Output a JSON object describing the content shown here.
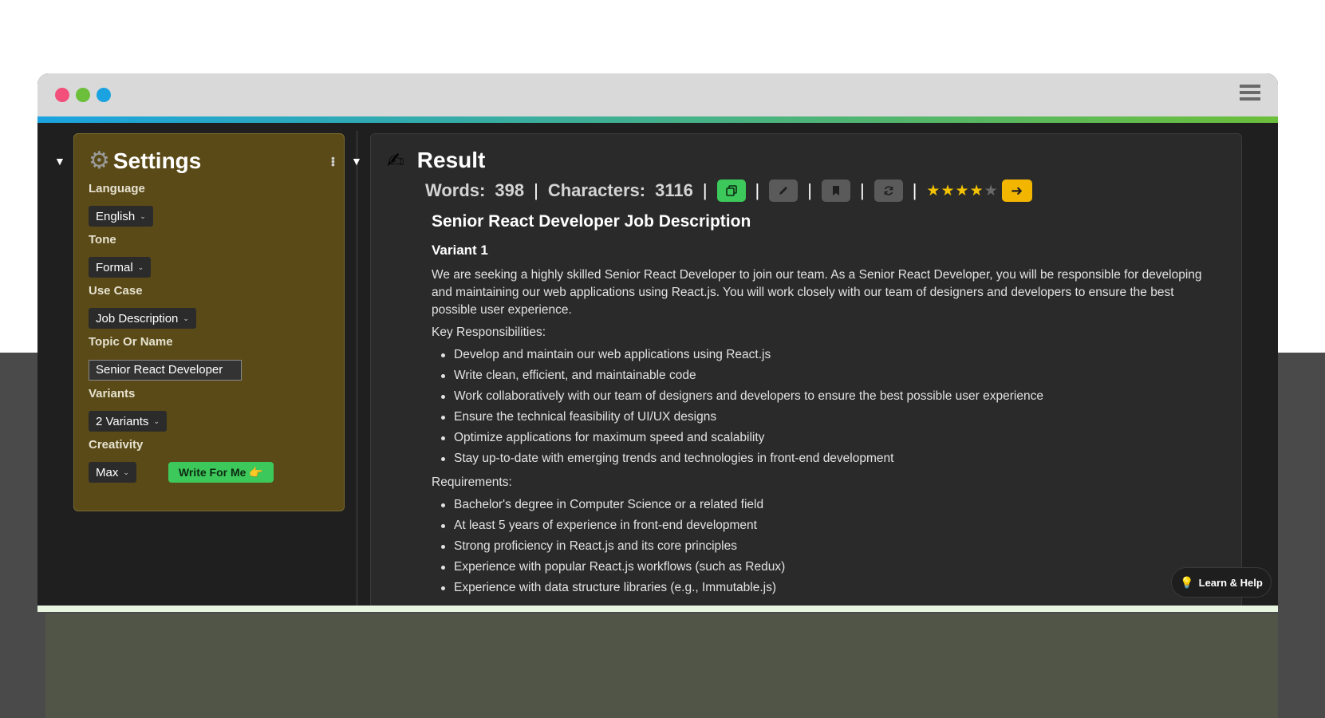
{
  "settings": {
    "title": "Settings",
    "language_label": "Language",
    "language_value": "English",
    "tone_label": "Tone",
    "tone_value": "Formal",
    "usecase_label": "Use Case",
    "usecase_value": "Job Description",
    "topic_label": "Topic Or Name",
    "topic_value": "Senior React Developer",
    "variants_label": "Variants",
    "variants_value": "2 Variants",
    "creativity_label": "Creativity",
    "creativity_value": "Max",
    "write_button": "Write For Me 👉"
  },
  "result": {
    "title": "Result",
    "words_label": "Words:",
    "words_value": "398",
    "chars_label": "Characters:",
    "chars_value": "3116",
    "rating": 4,
    "rating_max": 5
  },
  "document": {
    "heading": "Senior React Developer Job Description",
    "variant_title": "Variant 1",
    "intro": "We are seeking a highly skilled Senior React Developer to join our team. As a Senior React Developer, you will be responsible for developing and maintaining our web applications using React.js. You will work closely with our team of designers and developers to ensure the best possible user experience.",
    "responsibilities_title": "Key Responsibilities:",
    "responsibilities": [
      "Develop and maintain our web applications using React.js",
      "Write clean, efficient, and maintainable code",
      "Work collaboratively with our team of designers and developers to ensure the best possible user experience",
      "Ensure the technical feasibility of UI/UX designs",
      "Optimize applications for maximum speed and scalability",
      "Stay up-to-date with emerging trends and technologies in front-end development"
    ],
    "requirements_title": "Requirements:",
    "requirements": [
      "Bachelor's degree in Computer Science or a related field",
      "At least 5 years of experience in front-end development",
      "Strong proficiency in React.js and its core principles",
      "Experience with popular React.js workflows (such as Redux)",
      "Experience with data structure libraries (e.g., Immutable.js)"
    ]
  },
  "help": {
    "label": "Learn & Help"
  },
  "colors": {
    "settings_bg": "#5a4a18",
    "accent_green": "#3cc85a",
    "accent_yellow": "#f2b600"
  }
}
